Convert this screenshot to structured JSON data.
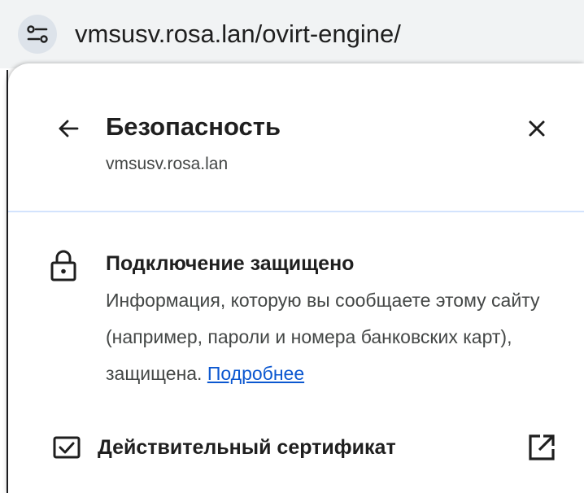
{
  "omnibox": {
    "site_info_icon": "tune-icon",
    "url": "vmsusv.rosa.lan/ovirt-engine/"
  },
  "popup": {
    "back_icon": "arrow-back-icon",
    "title": "Безопасность",
    "subtitle": "vmsusv.rosa.lan",
    "close_icon": "close-icon",
    "connection": {
      "icon": "lock-icon",
      "title": "Подключение защищено",
      "description": "Информация, которую вы сообщаете этому сайту (например, пароли и номера банковских карт), защищена.",
      "learn_more": "Подробнее"
    },
    "certificate": {
      "icon": "certificate-check-icon",
      "label": "Действительный сертификат",
      "external_icon": "open-in-new-icon"
    }
  },
  "colors": {
    "toolbar_bg": "#f1f3f4",
    "site_info_bg": "#dde3ea",
    "link": "#0b57d0",
    "divider": "#d3e3fd",
    "text_primary": "#1f1f1f",
    "text_secondary": "#444746"
  }
}
